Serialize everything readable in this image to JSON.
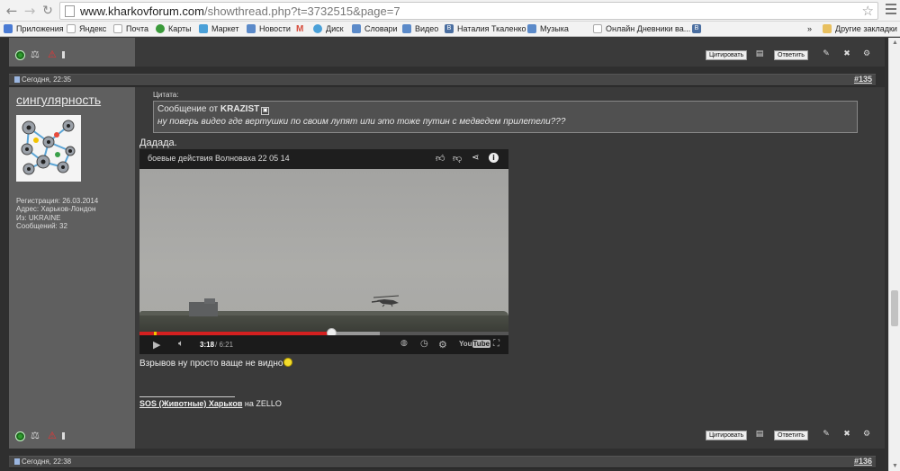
{
  "browser": {
    "url_host": "www.kharkovforum.com",
    "url_rest": "/showthread.php?t=3732515&page=7",
    "bookmarks": [
      {
        "label": "Приложения",
        "icon": "apps-grid-icon",
        "color": "#4a7bd4"
      },
      {
        "label": "Яндекс",
        "icon": "page-icon",
        "color": "#ffffff"
      },
      {
        "label": "Почта",
        "icon": "page-icon",
        "color": "#ffffff"
      },
      {
        "label": "Карты",
        "icon": "maps-icon",
        "color": "#3a9a3a"
      },
      {
        "label": "Маркет",
        "icon": "market-icon",
        "color": "#4aa0d8"
      },
      {
        "label": "Новости",
        "icon": "news-icon",
        "color": "#5b8ac9"
      },
      {
        "label": "",
        "icon": "gmail-icon",
        "color": "#d64b3b"
      },
      {
        "label": "Диск",
        "icon": "disk-icon",
        "color": "#4aa0d8"
      },
      {
        "label": "Словари",
        "icon": "dictionary-icon",
        "color": "#5b8ac9"
      },
      {
        "label": "Видео",
        "icon": "video-icon",
        "color": "#5b8ac9"
      },
      {
        "label": "Наталия Ткаленко",
        "icon": "vk-icon",
        "color": "#4a6ea0"
      },
      {
        "label": "Музыка",
        "icon": "music-icon",
        "color": "#5b8ac9"
      },
      {
        "label": "Онлайн Дневники ва...",
        "icon": "page-icon",
        "color": "#ffffff"
      },
      {
        "label": "",
        "icon": "vk-icon",
        "color": "#4a6ea0"
      },
      {
        "label": "»",
        "icon": "",
        "color": ""
      },
      {
        "label": "Другие закладки",
        "icon": "folder-icon",
        "color": "#e8c060"
      }
    ]
  },
  "posts": {
    "prev_footer": {
      "quote_label": "Цитировать",
      "reply_label": "Ответить"
    },
    "post_135": {
      "date": "Сегодня, 22:35",
      "number": "#135",
      "username": "сингулярность",
      "info": [
        "Регистрация: 26.03.2014",
        "Адрес: Харьков-Лондон",
        "Из: UKRAINE",
        "Сообщений: 32"
      ],
      "quote_label": "Цитата:",
      "quote_author_prefix": "Сообщение от ",
      "quote_author": "KRAZIST",
      "quote_text": "ну поверь видео где вертушки по своим лупят или это тоже путин с медведем прилетели???",
      "text_before_video": "Дадада.",
      "video": {
        "title": "боевые действия Волноваха 22 05 14",
        "time_current": "3:18",
        "time_total": "/ 6:21",
        "played_fraction": 0.52,
        "buffered_fraction": 0.65,
        "logo": "You Tube"
      },
      "text_after_video": "Взрывов ну просто ваще не видно",
      "signature_bold": "SOS (Животные) Харьков",
      "signature_rest": " на ZELLO",
      "quote_button": "Цитировать",
      "reply_button": "Ответить"
    },
    "post_136": {
      "date": "Сегодня, 22:38",
      "number": "#136"
    }
  }
}
